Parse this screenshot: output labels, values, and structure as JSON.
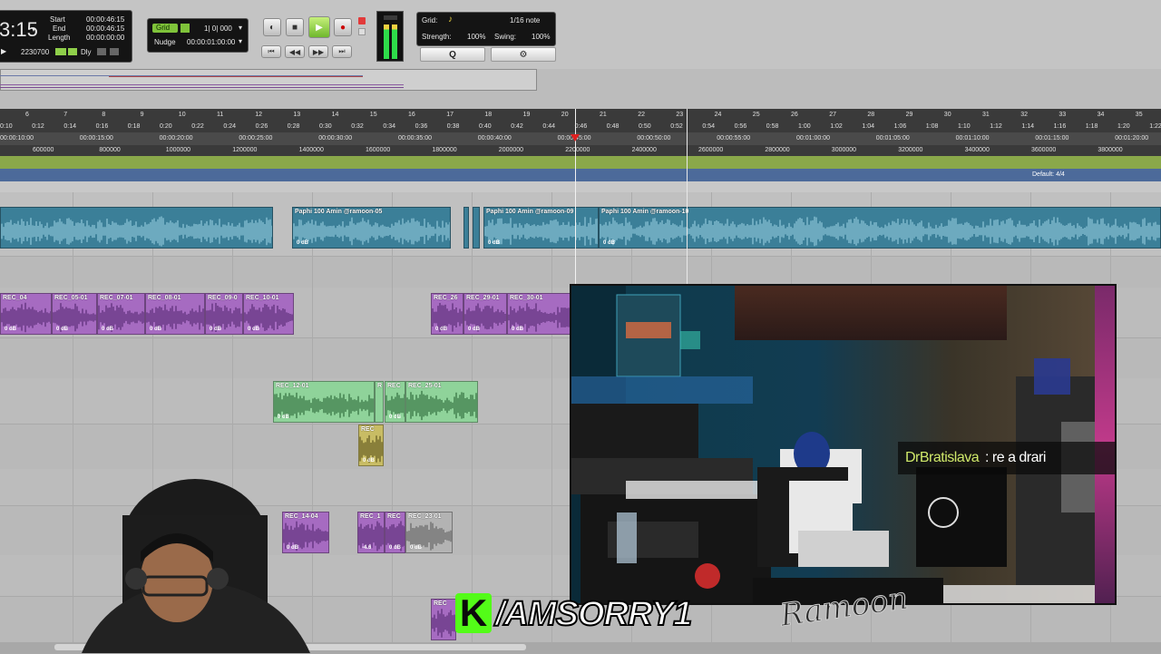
{
  "transport": {
    "main_counter": "3:15",
    "start_label": "Start",
    "end_label": "End",
    "length_label": "Length",
    "start_value": "00:00:46:15",
    "end_value": "00:00:46:15",
    "length_value": "00:00:00:00",
    "samples_value": "2230700",
    "dly_label": "Dly"
  },
  "grid": {
    "grid_label": "Grid",
    "grid_value": "1| 0| 000",
    "nudge_label": "Nudge",
    "nudge_value": "00:00:01:00:00"
  },
  "mode_panel": {
    "grid_label": "Grid:",
    "note_value": "1/16 note",
    "strength_label": "Strength:",
    "strength_value": "100%",
    "swing_label": "Swing:",
    "swing_value": "100%",
    "q_button": "Q"
  },
  "ruler": {
    "bars": [
      "6",
      "7",
      "8",
      "9",
      "10",
      "11",
      "12",
      "13",
      "14",
      "15",
      "16",
      "17",
      "18",
      "19",
      "20",
      "21",
      "22",
      "23",
      "24",
      "25",
      "26",
      "27",
      "28",
      "29",
      "30",
      "31",
      "32",
      "33",
      "34",
      "35"
    ],
    "minsecs": [
      "0:10",
      "0:12",
      "0:14",
      "0:16",
      "0:18",
      "0:20",
      "0:22",
      "0:24",
      "0:26",
      "0:28",
      "0:30",
      "0:32",
      "0:34",
      "0:36",
      "0:38",
      "0:40",
      "0:42",
      "0:44",
      "0:46",
      "0:48",
      "0:50",
      "0:52",
      "0:54",
      "0:56",
      "0:58",
      "1:00",
      "1:02",
      "1:04",
      "1:06",
      "1:08",
      "1:10",
      "1:12",
      "1:14",
      "1:16",
      "1:18",
      "1:20",
      "1:22"
    ],
    "timecode": [
      "00:00:10:00",
      "00:00:15:00",
      "00:00:20:00",
      "00:00:25:00",
      "00:00:30:00",
      "00:00:35:00",
      "00:00:40:00",
      "00:00:45:00",
      "00:00:50:00",
      "00:00:55:00",
      "00:01:00:00",
      "00:01:05:00",
      "00:01:10:00",
      "00:01:15:00",
      "00:01:20:00"
    ],
    "samples": [
      "600000",
      "800000",
      "1000000",
      "1200000",
      "1400000",
      "1600000",
      "1800000",
      "2000000",
      "2200000",
      "2400000",
      "2600000",
      "2800000",
      "3000000",
      "3200000",
      "3400000",
      "3600000",
      "3800000"
    ],
    "meter_label": "Default: 4/4"
  },
  "clips": {
    "blue": [
      {
        "name": "",
        "gain": ""
      },
      {
        "name": "Paphi 100 Amin @ramoon-05",
        "gain": "0 dB"
      },
      {
        "name": "Paphi 100 Amin @ramoon-09",
        "gain": "0 dB"
      },
      {
        "name": "Paphi 100 Amin @ramoon-10",
        "gain": "0 dB"
      }
    ],
    "purple": [
      {
        "name": "REC_04",
        "gain": "0 dB"
      },
      {
        "name": "REC_05-01",
        "gain": "0 dB"
      },
      {
        "name": "REC_07-01",
        "gain": "0 dB"
      },
      {
        "name": "REC_08-01",
        "gain": "0 dB"
      },
      {
        "name": "REC_09-0",
        "gain": "0 dB"
      },
      {
        "name": "REC_10-01",
        "gain": "0 dB"
      },
      {
        "name": "REC_26",
        "gain": "0 dB"
      },
      {
        "name": "REC_29-01",
        "gain": "0 dB"
      },
      {
        "name": "REC_30-01",
        "gain": "0 dB"
      }
    ],
    "green": [
      {
        "name": "REC_12-01",
        "gain": "0 dB"
      },
      {
        "name": "R",
        "gain": ""
      },
      {
        "name": "REC",
        "gain": "0 dB"
      },
      {
        "name": "REC_25-01",
        "gain": ""
      }
    ],
    "olive": [
      {
        "name": "REC",
        "gain": "0 dB"
      }
    ],
    "lower": [
      {
        "name": "REC_14-04",
        "gain": "0 dB"
      },
      {
        "name": "REC_1",
        "gain": "-4.6"
      },
      {
        "name": "REC",
        "gain": "0 dB"
      },
      {
        "name": "REC_23-01",
        "gain": "0 dB"
      },
      {
        "name": "REC",
        "gain": ""
      }
    ]
  },
  "chat": {
    "username": "DrBratislava",
    "message": " : re a drari"
  },
  "overlay": {
    "kick_handle": "/AMSORRY1",
    "kick_logo": "K",
    "signature": "Ramoon"
  },
  "colors": {
    "blue_clip": "#3b7f98",
    "purple_clip": "#a66bc1",
    "green_clip": "#8fd39a",
    "kick_green": "#53fc18",
    "chat_name": "#cfe86a"
  }
}
